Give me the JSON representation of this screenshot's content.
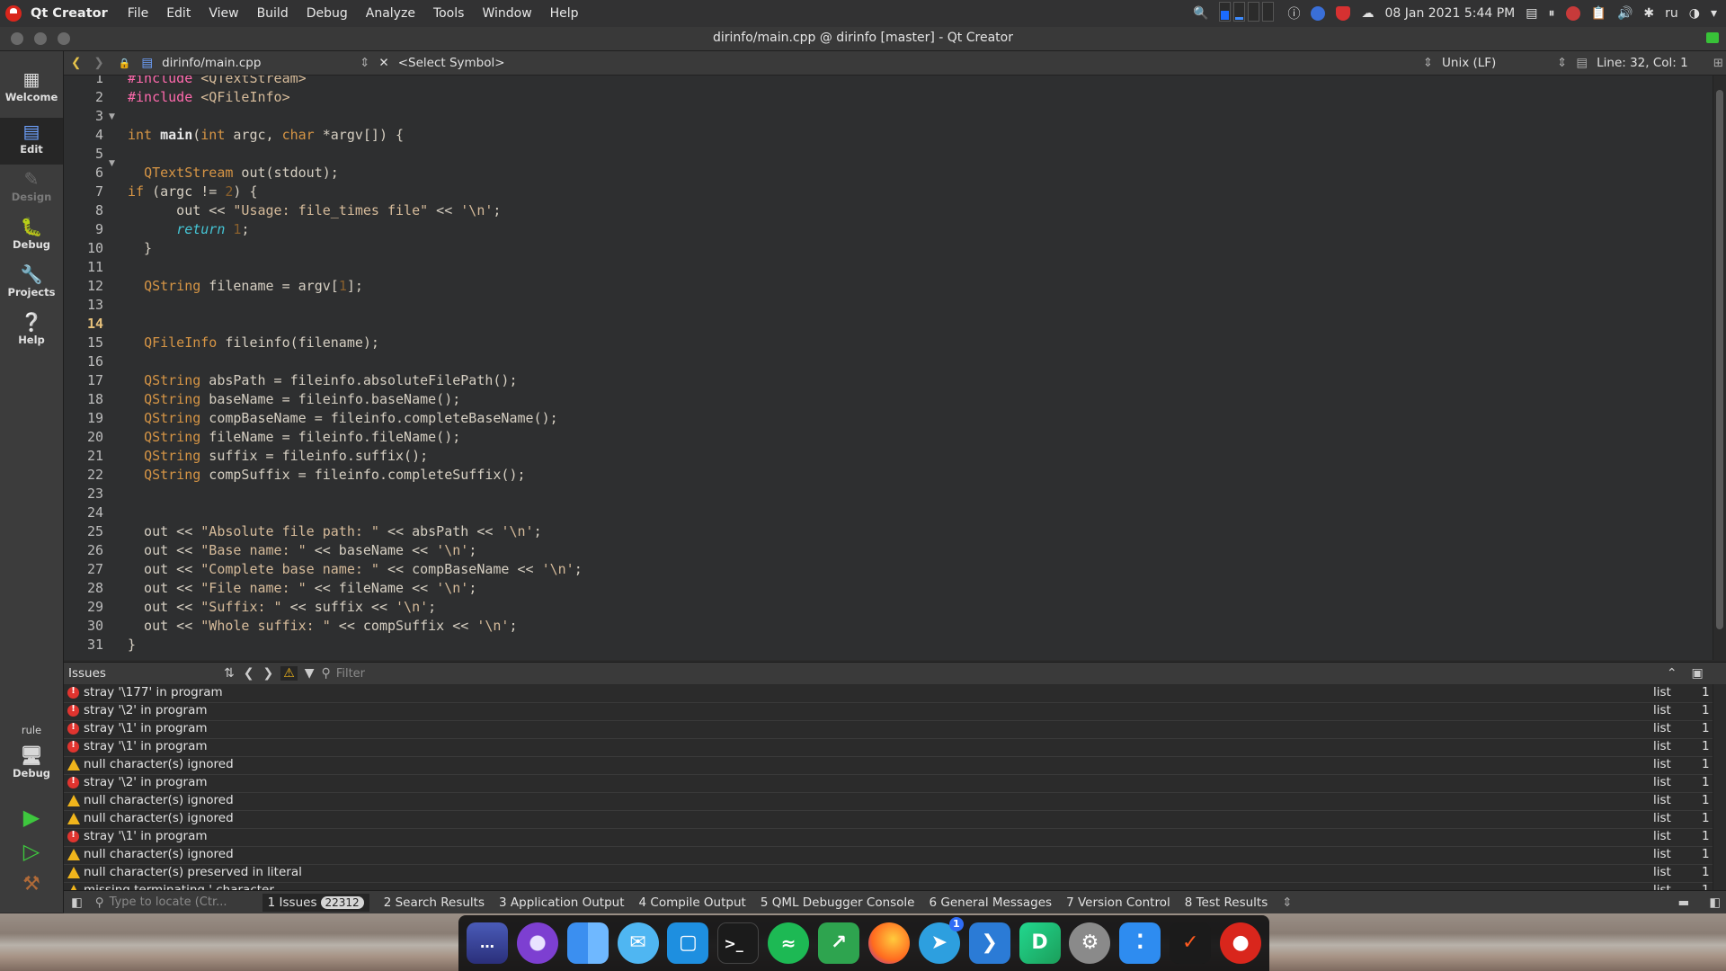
{
  "menubar": {
    "app_name": "Qt Creator",
    "menus": [
      "File",
      "Edit",
      "View",
      "Build",
      "Debug",
      "Analyze",
      "Tools",
      "Window",
      "Help"
    ],
    "clock": "08 Jan 2021 5:44 PM",
    "keyboard_layout": "ru"
  },
  "window": {
    "title": "dirinfo/main.cpp @ dirinfo [master] - Qt Creator"
  },
  "modes": {
    "welcome": "Welcome",
    "edit": "Edit",
    "design": "Design",
    "debug": "Debug",
    "projects": "Projects",
    "help": "Help",
    "kit_label": "rule",
    "kit_build": "Debug"
  },
  "editor_toolbar": {
    "file": "dirinfo/main.cpp",
    "symbol": "<Select Symbol>",
    "line_ending": "Unix (LF)",
    "position": "Line: 32, Col: 1"
  },
  "editor": {
    "current_line": 14,
    "line_numbers": [
      "1",
      "2",
      "3",
      "4",
      "5",
      "6",
      "7",
      "8",
      "9",
      "10",
      "11",
      "12",
      "13",
      "14",
      "15",
      "16",
      "17",
      "18",
      "19",
      "20",
      "21",
      "22",
      "23",
      "24",
      "25",
      "26",
      "27",
      "28",
      "29",
      "30",
      "31"
    ]
  },
  "issues_pane": {
    "title": "Issues",
    "filter_placeholder": "Filter",
    "rows": [
      {
        "severity": "error",
        "text": "stray '\\177' in program",
        "file": "list",
        "line": "1"
      },
      {
        "severity": "error",
        "text": "stray '\\2' in program",
        "file": "list",
        "line": "1"
      },
      {
        "severity": "error",
        "text": "stray '\\1' in program",
        "file": "list",
        "line": "1"
      },
      {
        "severity": "error",
        "text": "stray '\\1' in program",
        "file": "list",
        "line": "1"
      },
      {
        "severity": "warning",
        "text": "null character(s) ignored",
        "file": "list",
        "line": "1"
      },
      {
        "severity": "error",
        "text": "stray '\\2' in program",
        "file": "list",
        "line": "1"
      },
      {
        "severity": "warning",
        "text": "null character(s) ignored",
        "file": "list",
        "line": "1"
      },
      {
        "severity": "warning",
        "text": "null character(s) ignored",
        "file": "list",
        "line": "1"
      },
      {
        "severity": "error",
        "text": "stray '\\1' in program",
        "file": "list",
        "line": "1"
      },
      {
        "severity": "warning",
        "text": "null character(s) ignored",
        "file": "list",
        "line": "1"
      },
      {
        "severity": "warning",
        "text": "null character(s) preserved in literal",
        "file": "list",
        "line": "1"
      },
      {
        "severity": "warning",
        "text": "missing terminating ' character",
        "file": "list",
        "line": "1"
      }
    ]
  },
  "output_bar": {
    "locator_placeholder": "Type to locate (Ctr...",
    "tabs": [
      {
        "num": "1",
        "label": "Issues",
        "badge": "22312"
      },
      {
        "num": "2",
        "label": "Search Results"
      },
      {
        "num": "3",
        "label": "Application Output"
      },
      {
        "num": "4",
        "label": "Compile Output"
      },
      {
        "num": "5",
        "label": "QML Debugger Console"
      },
      {
        "num": "6",
        "label": "General Messages"
      },
      {
        "num": "7",
        "label": "Version Control"
      },
      {
        "num": "8",
        "label": "Test Results"
      }
    ]
  },
  "dock": {
    "telegram_badge": "1",
    "icons": [
      "launchpad-icon",
      "tor-browser-icon",
      "finder-icon",
      "mail-icon",
      "virtualbox-icon",
      "terminal-icon",
      "spotify-icon",
      "git-client-icon",
      "firefox-icon",
      "telegram-icon",
      "vscode-icon",
      "datagrip-icon",
      "settings-icon",
      "sourcetree-icon",
      "filezilla-icon",
      "qtcreator-icon"
    ]
  },
  "colors": {
    "keyword": "#d69545",
    "string": "#d6bb9a",
    "number": "#8a602c",
    "preprocessor": "#ff6aad",
    "error": "#e0342f",
    "warning": "#f0b51c"
  }
}
